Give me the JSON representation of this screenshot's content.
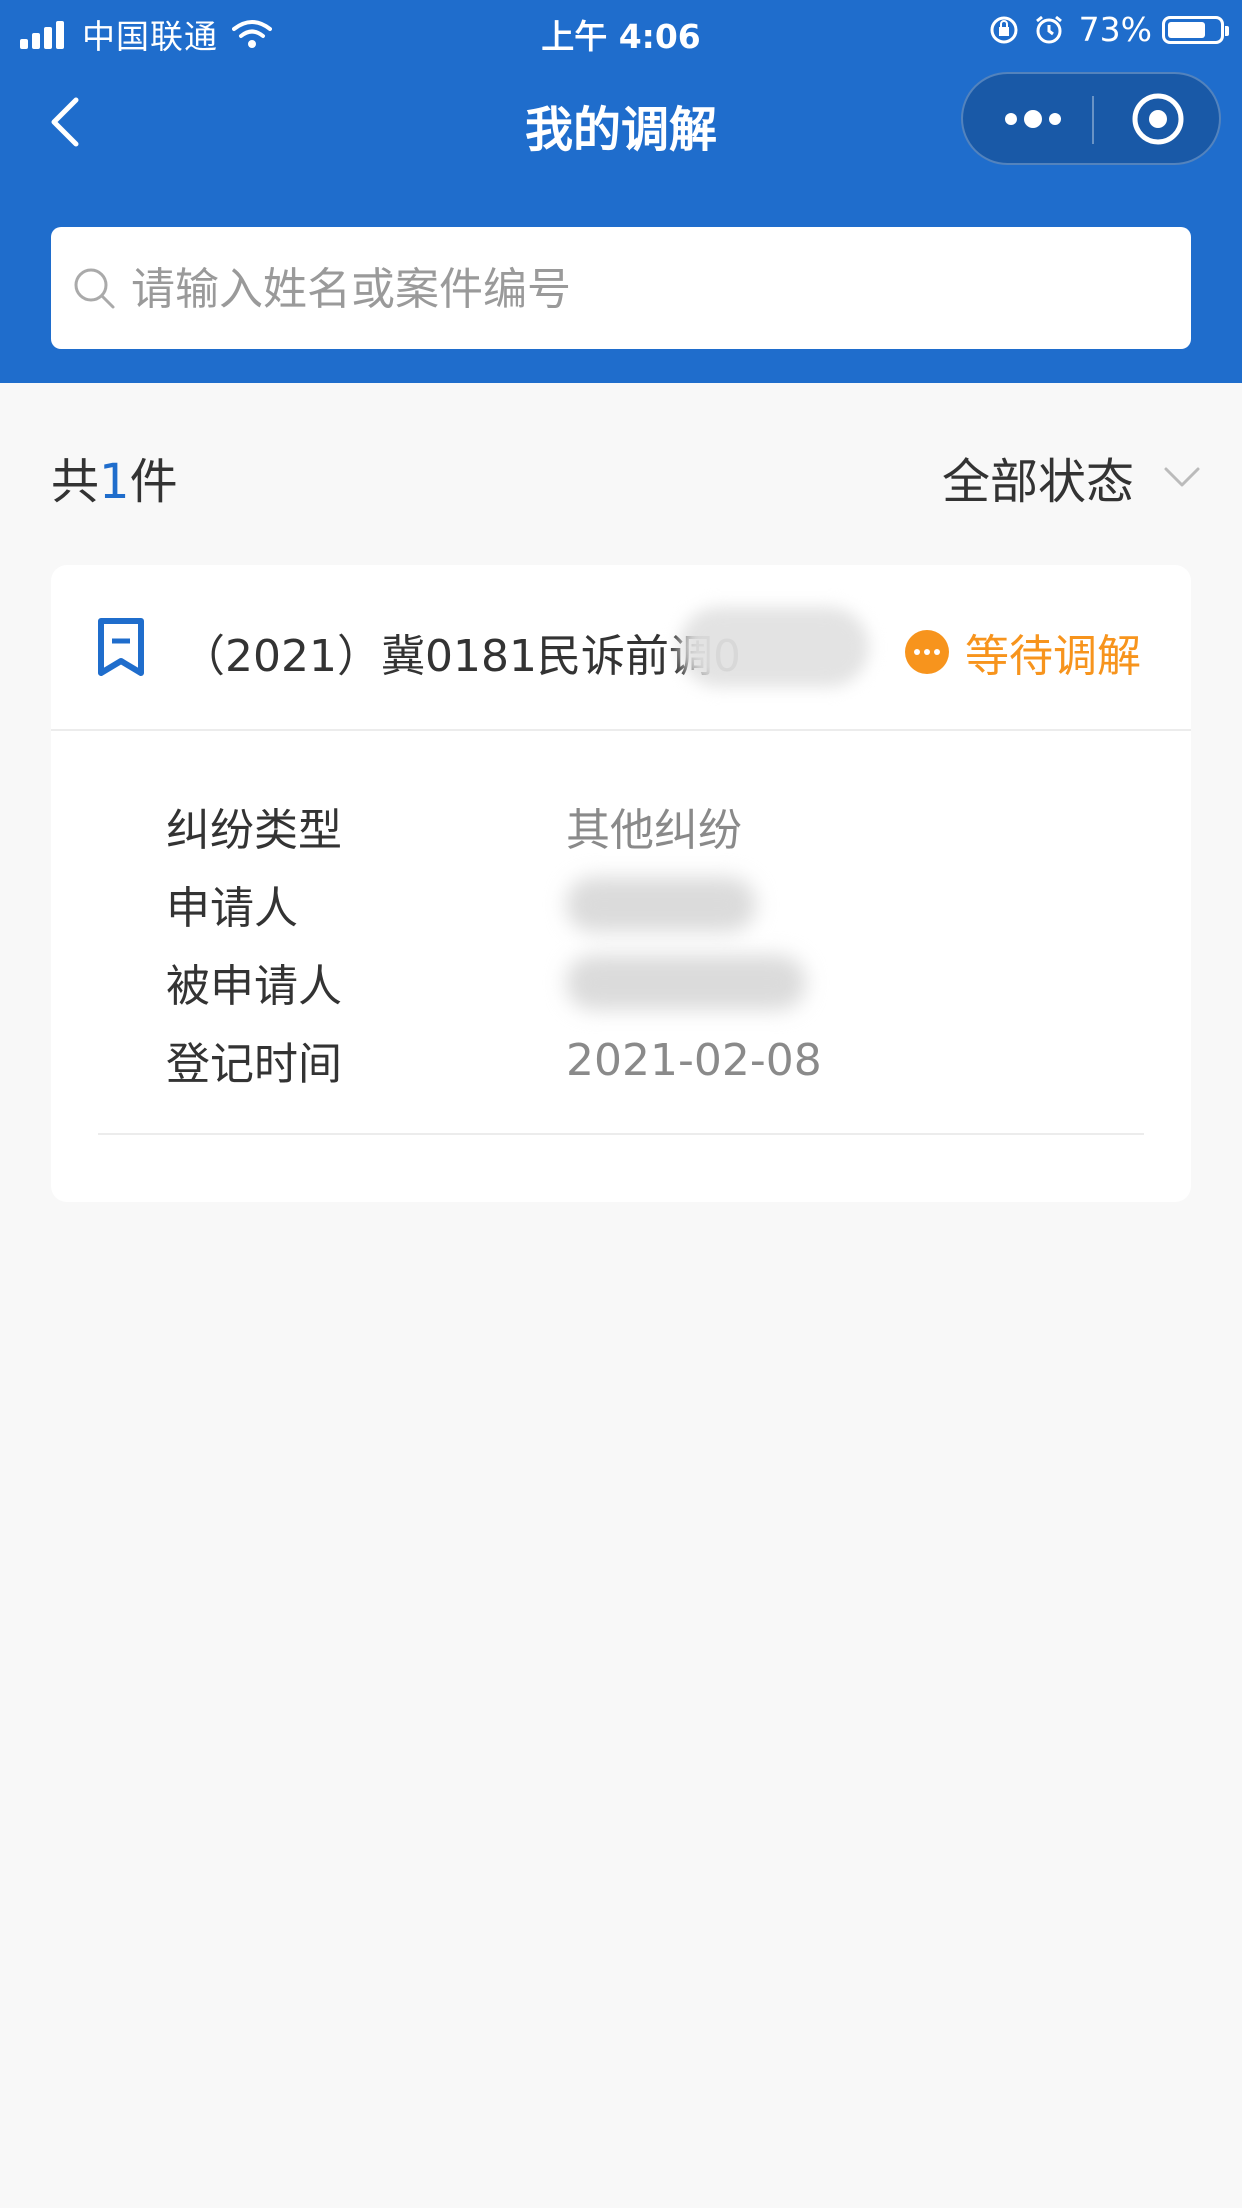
{
  "status_bar": {
    "carrier": "中国联通",
    "time": "上午 4:06",
    "battery": "73%",
    "battery_level": 0.73
  },
  "nav": {
    "title": "我的调解"
  },
  "search": {
    "placeholder": "请输入姓名或案件编号",
    "value": ""
  },
  "summary": {
    "prefix": "共",
    "count": "1",
    "suffix": "件",
    "filter_label": "全部状态"
  },
  "case": {
    "number": "（2021）冀0181民诉前调0",
    "status": "等待调解",
    "fields": [
      {
        "label": "纠纷类型",
        "value": "其他纠纷"
      },
      {
        "label": "申请人",
        "value": ""
      },
      {
        "label": "被申请人",
        "value": ""
      },
      {
        "label": "登记时间",
        "value": "2021-02-08"
      }
    ]
  },
  "colors": {
    "primary": "#1f6dcc",
    "status_orange": "#f7941d",
    "background": "#f8f8f8"
  }
}
